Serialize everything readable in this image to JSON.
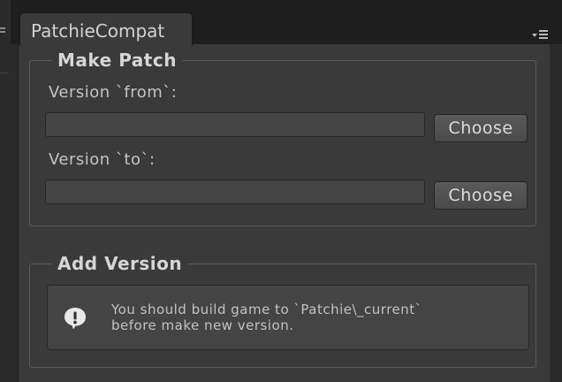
{
  "window": {
    "tab_title": "PatchieCompat",
    "menu_icon": "window-menu-icon"
  },
  "make_patch": {
    "title": "Make Patch",
    "from_label": "Version `from`:",
    "from_value": "",
    "from_button": "Choose",
    "to_label": "Version `to`:",
    "to_value": "",
    "to_button": "Choose"
  },
  "add_version": {
    "title": "Add Version",
    "info_icon": "info-exclamation-icon",
    "help_lines": [
      "You should build game to `Patchie\\_current`",
      "before make new version."
    ]
  }
}
